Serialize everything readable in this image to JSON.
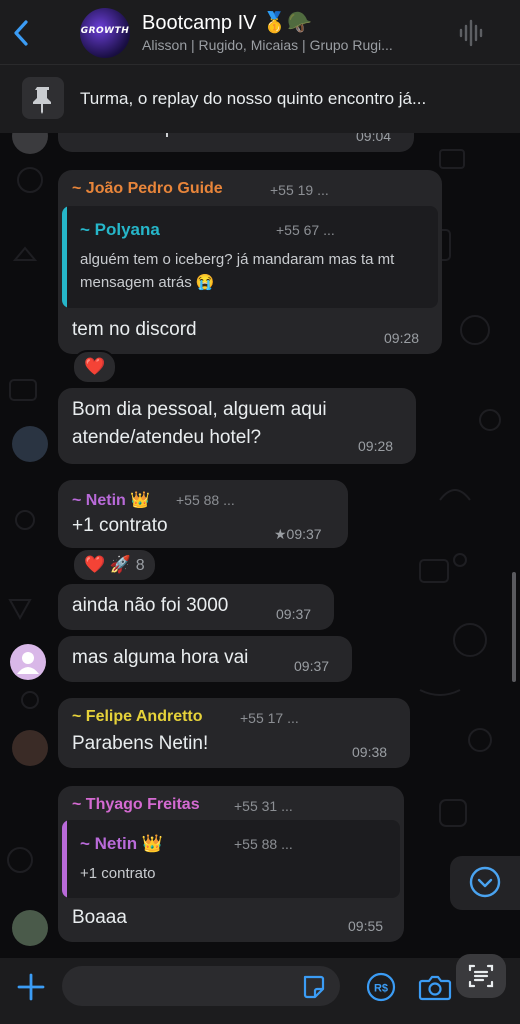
{
  "header": {
    "title": "Bootcamp IV 🥇🪖",
    "subtitle": "Alisson | Rugido, Micaias | Grupo Rugi...",
    "avatar_text": "GROWTH"
  },
  "pinned": {
    "text": "Turma, o replay do nosso quinto encontro já..."
  },
  "messages": [
    {
      "text": "vezes e exportar uma",
      "time": "09:04"
    },
    {
      "sender": "~ João Pedro Guide",
      "phone": "+55 19 ...",
      "quote_sender": "~ Polyana",
      "quote_phone": "+55 67 ...",
      "quote_text": "alguém tem o iceberg? já mandaram mas ta mt mensagem atrás 😭",
      "text": "tem no discord",
      "time": "09:28",
      "reaction": "❤️"
    },
    {
      "text": "Bom dia pessoal, alguem aqui atende/atendeu hotel?",
      "text_line1": "Bom dia pessoal, alguem aqui",
      "text_line2": "atende/atendeu hotel?",
      "time": "09:28"
    },
    {
      "sender": "~ Netin 👑",
      "phone": "+55 88 ...",
      "text": "+1 contrato",
      "time": "★09:37",
      "reaction": "❤️ 🚀",
      "reaction_count": "8"
    },
    {
      "text": "ainda não foi 3000",
      "time": "09:37"
    },
    {
      "text": "mas alguma hora vai",
      "time": "09:37"
    },
    {
      "sender": "~ Felipe Andretto",
      "phone": "+55 17 ...",
      "text": "Parabens Netin!",
      "time": "09:38"
    },
    {
      "sender": "~ Thyago Freitas",
      "phone": "+55 31 ...",
      "quote_sender": "~ Netin 👑",
      "quote_phone": "+55 88 ...",
      "quote_text": "+1 contrato",
      "text": "Boaaa",
      "time": "09:55"
    }
  ],
  "colors": {
    "joao": "#e8853a",
    "polyana": "#26b6c9",
    "netin": "#b96ad9",
    "felipe": "#e6d23a",
    "thyago": "#d46ad1",
    "accent": "#4aa3f0"
  },
  "icons": {
    "back": "chevron-left-icon",
    "wave": "audio-wave-icon",
    "pin": "pin-icon",
    "plus": "plus-icon",
    "sticker": "sticker-icon",
    "money": "payment-icon",
    "camera": "camera-icon",
    "scan": "scan-text-icon",
    "down": "chevron-down-icon"
  }
}
